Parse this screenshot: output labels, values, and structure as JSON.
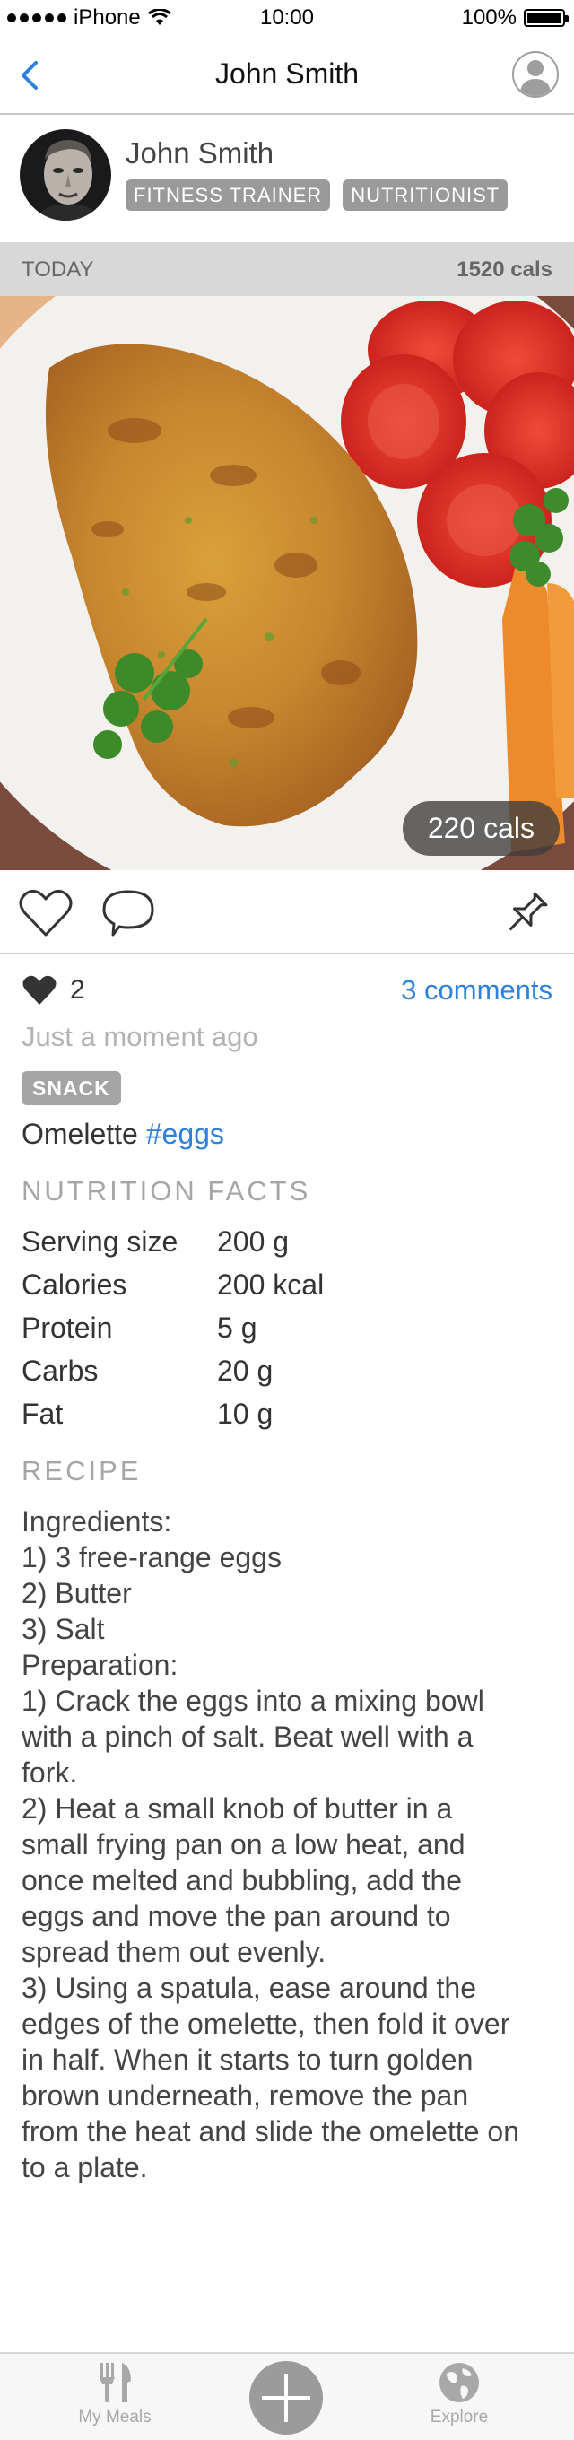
{
  "status_bar": {
    "carrier": "iPhone",
    "time": "10:00",
    "battery_percent": "100%",
    "battery_level": 1.0
  },
  "nav": {
    "title": "John Smith",
    "back_icon": "chevron-left-icon",
    "profile_icon": "user-circle-icon",
    "accent_color": "#2f7fdc"
  },
  "profile": {
    "name": "John Smith",
    "tags": [
      "FITNESS TRAINER",
      "NUTRITIONIST"
    ]
  },
  "day_summary": {
    "label": "TODAY",
    "total": "1520 cals"
  },
  "meal": {
    "image_calories": "220 cals",
    "likes_count": "2",
    "comments_link": "3 comments",
    "posted": "Just a moment ago",
    "type_tag": "SNACK",
    "caption_text": "Omelette",
    "caption_hashtag": "#eggs"
  },
  "nutrition": {
    "title": "NUTRITION FACTS",
    "rows": [
      {
        "label": "Serving size",
        "value": "200 g"
      },
      {
        "label": "Calories",
        "value": "200 kcal"
      },
      {
        "label": "Protein",
        "value": "5 g"
      },
      {
        "label": "Carbs",
        "value": "20 g"
      },
      {
        "label": "Fat",
        "value": "10 g"
      }
    ]
  },
  "recipe": {
    "title": "RECIPE",
    "lines": [
      "Ingredients:",
      "1) 3 free-range eggs",
      "2) Butter",
      "3) Salt",
      "Preparation:",
      "1) Crack the eggs into a mixing bowl with a pinch of salt. Beat well with a fork.",
      "2) Heat a small knob of butter in a small frying pan on a low heat, and once melted and bubbling, add the eggs and move the pan around to spread them out evenly.",
      "3) Using a spatula, ease around the edges of the omelette, then fold it over in half. When it starts to turn golden brown underneath, remove the pan from the heat and slide the omelette on to a plate."
    ]
  },
  "tab_bar": {
    "items": [
      {
        "label": "My Meals",
        "icon": "fork-knife-icon"
      },
      {
        "label": "",
        "icon": "plus-icon"
      },
      {
        "label": "Explore",
        "icon": "globe-icon"
      }
    ]
  }
}
